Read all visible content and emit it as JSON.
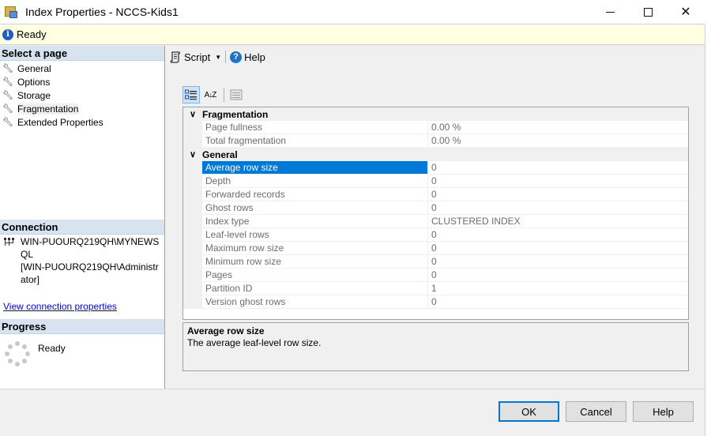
{
  "window": {
    "title": "Index Properties - NCCS-Kids1",
    "minimize_icon": "minimize-icon",
    "maximize_icon": "maximize-icon",
    "close_icon": "close-icon",
    "close_glyph": "✕"
  },
  "status": {
    "icon": "info-icon",
    "icon_glyph": "i",
    "text": "Ready"
  },
  "select_page": {
    "header": "Select a page",
    "items": [
      {
        "label": "General",
        "icon": "wrench-icon"
      },
      {
        "label": "Options",
        "icon": "wrench-icon"
      },
      {
        "label": "Storage",
        "icon": "wrench-icon"
      },
      {
        "label": "Fragmentation",
        "icon": "wrench-icon",
        "selected": true
      },
      {
        "label": "Extended Properties",
        "icon": "wrench-icon"
      }
    ]
  },
  "connection": {
    "header": "Connection",
    "icon": "connection-icon",
    "server": "WIN-PUOURQ219QH\\MYNEWSQL",
    "user": "[WIN-PUOURQ219QH\\Administrator]",
    "link": "View connection properties"
  },
  "progress": {
    "header": "Progress",
    "icon": "spinner-icon",
    "text": "Ready"
  },
  "toolbar": {
    "script_label": "Script",
    "script_icon": "script-icon",
    "help_label": "Help",
    "help_icon": "help-icon",
    "help_glyph": "?"
  },
  "grid_toolbar": {
    "categorized_icon": "categorized-icon",
    "alphabetical_icon": "sort-alphabetical-icon",
    "alphabetical_glyph": "A↓Z",
    "property_pages_icon": "property-pages-icon"
  },
  "property_grid": {
    "categories": [
      {
        "name": "Fragmentation",
        "expanded": true,
        "properties": [
          {
            "name": "Page fullness",
            "value": "0.00 %"
          },
          {
            "name": "Total fragmentation",
            "value": "0.00 %"
          }
        ]
      },
      {
        "name": "General",
        "expanded": true,
        "properties": [
          {
            "name": "Average row size",
            "value": "0",
            "selected": true
          },
          {
            "name": "Depth",
            "value": "0"
          },
          {
            "name": "Forwarded records",
            "value": "0"
          },
          {
            "name": "Ghost rows",
            "value": "0"
          },
          {
            "name": "Index type",
            "value": "CLUSTERED INDEX"
          },
          {
            "name": "Leaf-level rows",
            "value": "0"
          },
          {
            "name": "Maximum row size",
            "value": "0"
          },
          {
            "name": "Minimum row size",
            "value": "0"
          },
          {
            "name": "Pages",
            "value": "0"
          },
          {
            "name": "Partition ID",
            "value": "1"
          },
          {
            "name": "Version ghost rows",
            "value": "0"
          }
        ]
      }
    ]
  },
  "description": {
    "title": "Average row size",
    "text": "The average leaf-level row size."
  },
  "buttons": {
    "ok": "OK",
    "cancel": "Cancel",
    "help": "Help"
  },
  "colors": {
    "selection": "#0078d7",
    "status_bg": "#ffffe1",
    "section_header_bg": "#d8e3f0",
    "link": "#0000ee"
  }
}
